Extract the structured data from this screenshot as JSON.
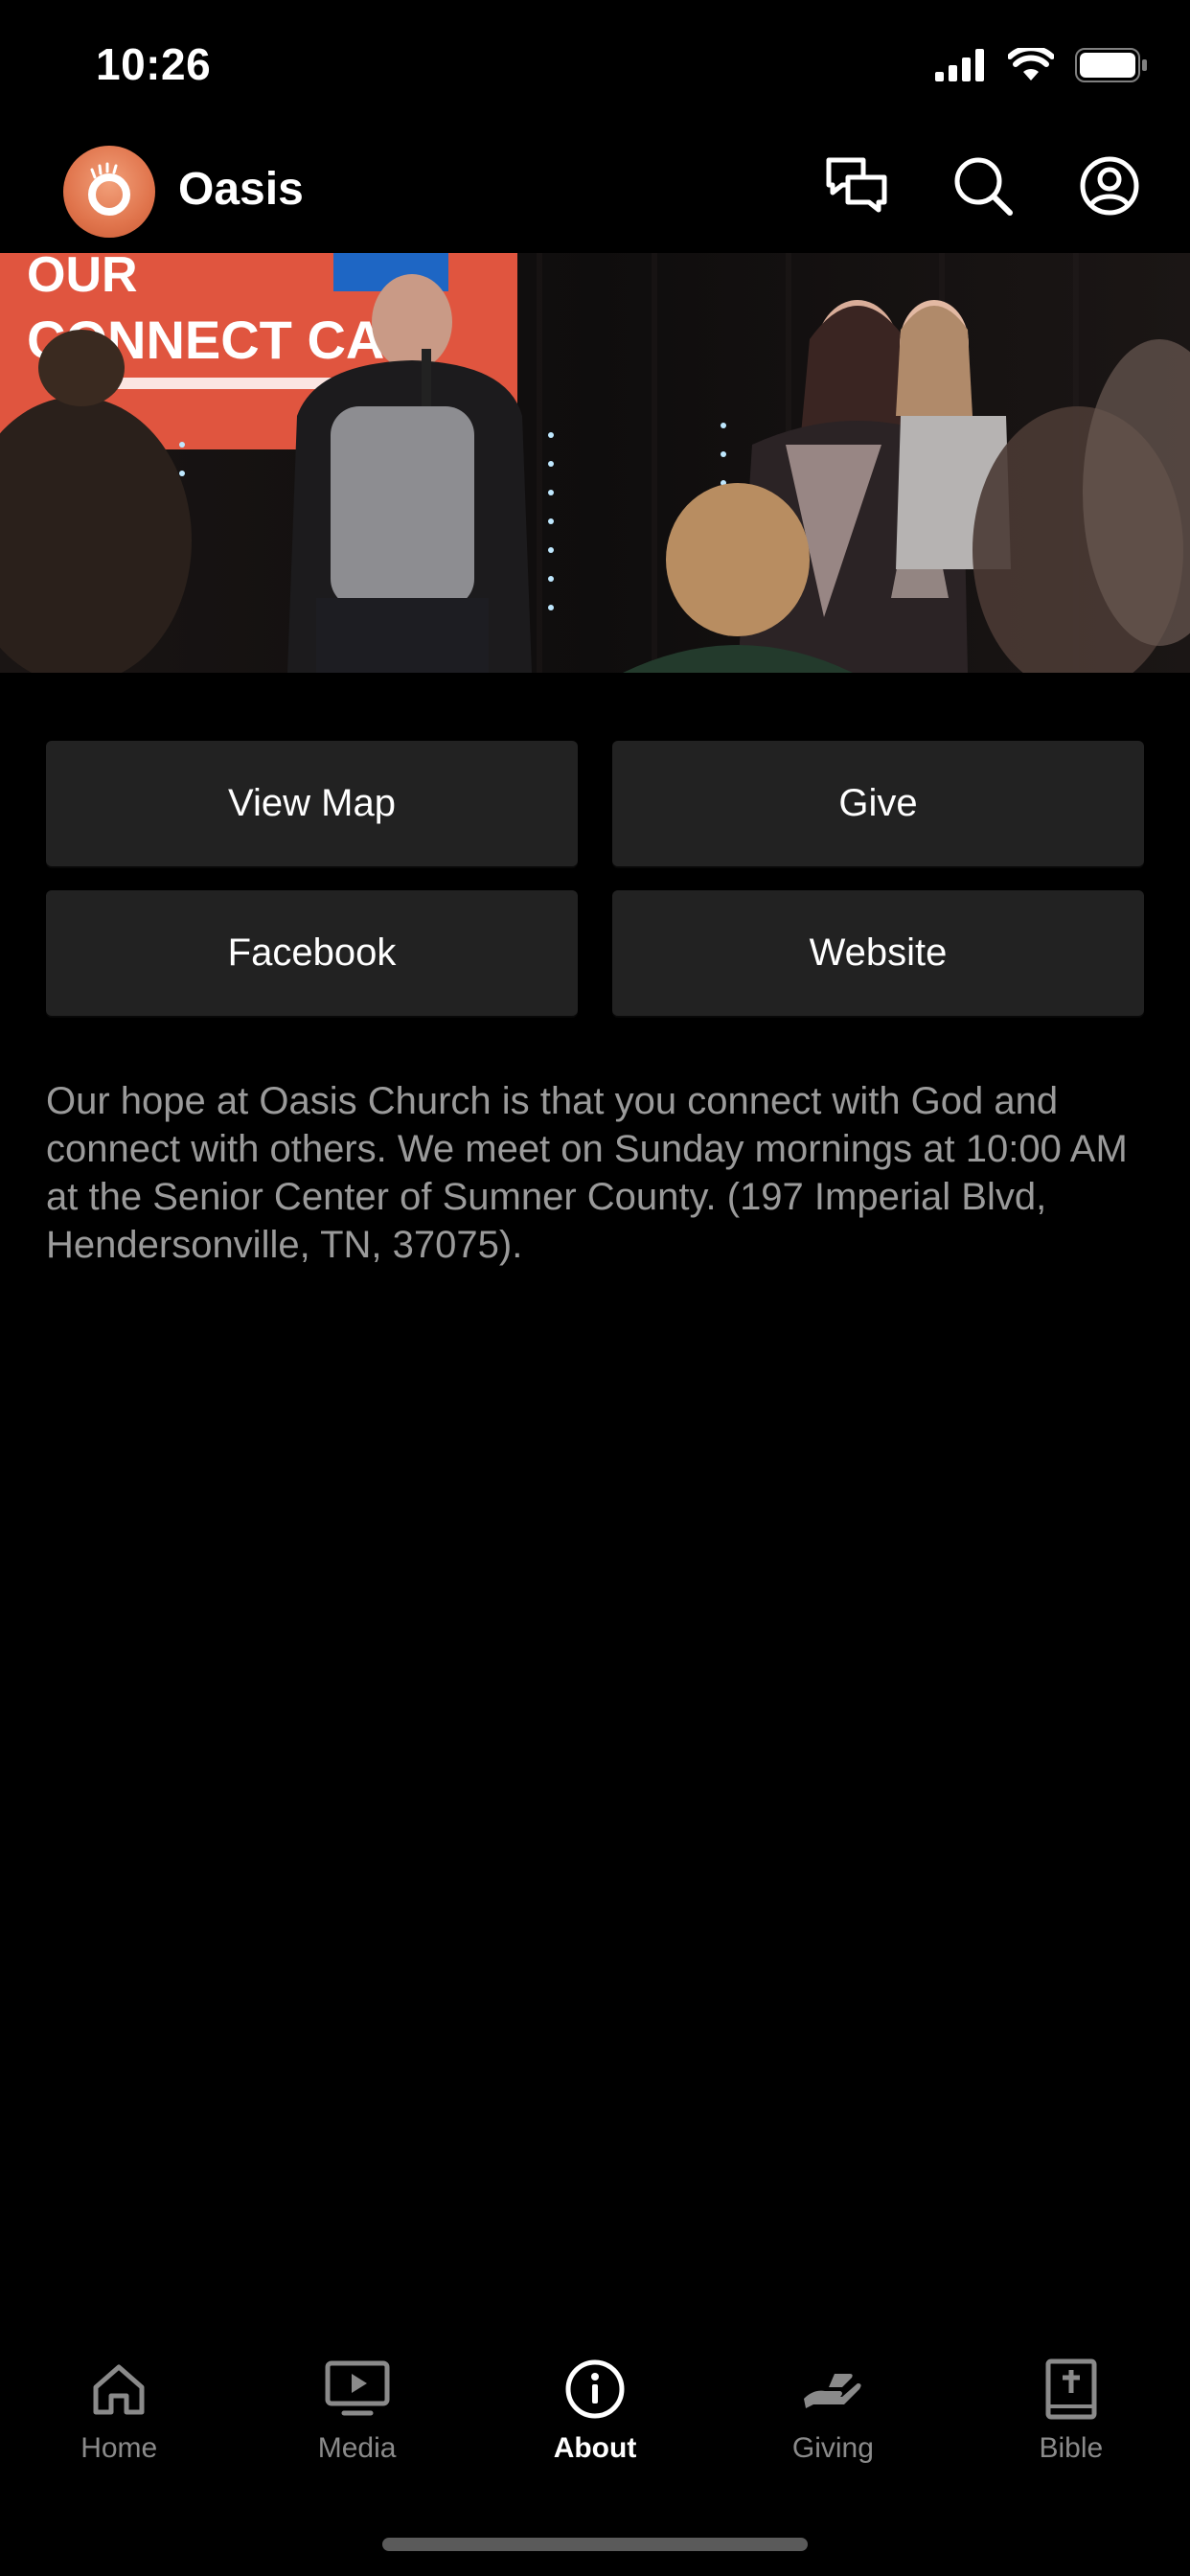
{
  "status_bar": {
    "time": "10:26"
  },
  "header": {
    "app_title": "Oasis",
    "actions": [
      {
        "icon": "chat-icon"
      },
      {
        "icon": "search-icon"
      },
      {
        "icon": "profile-icon"
      }
    ]
  },
  "hero": {
    "screen_text_line1": "OUR",
    "screen_text_line2": "CONNECT CA"
  },
  "buttons": {
    "view_map": "View Map",
    "give": "Give",
    "facebook": "Facebook",
    "website": "Website"
  },
  "description": "Our hope at Oasis Church is that you connect with God and connect with others. We meet on Sunday mornings at 10:00 AM at the Senior Center of Sumner County. (197 Imperial Blvd, Hendersonville, TN, 37075).",
  "tabs": [
    {
      "label": "Home",
      "icon": "home-icon",
      "active": false
    },
    {
      "label": "Media",
      "icon": "media-icon",
      "active": false
    },
    {
      "label": "About",
      "icon": "info-icon",
      "active": true
    },
    {
      "label": "Giving",
      "icon": "giving-icon",
      "active": false
    },
    {
      "label": "Bible",
      "icon": "bible-icon",
      "active": false
    }
  ],
  "colors": {
    "background": "#000000",
    "button_bg": "#222222",
    "text_muted": "#9a9a9a",
    "tab_inactive": "#8a8a8a",
    "brand": "#e0744c"
  }
}
